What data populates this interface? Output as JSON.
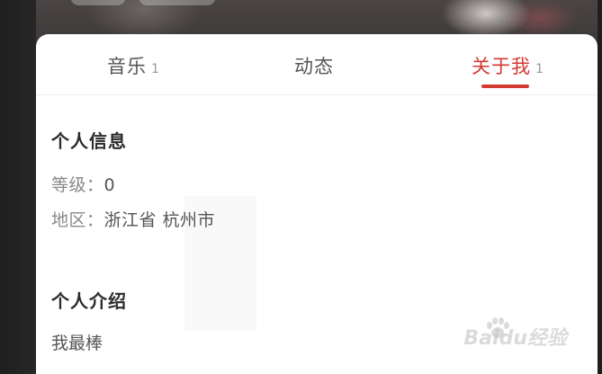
{
  "tabs": [
    {
      "label": "音乐",
      "count": "1",
      "active": false
    },
    {
      "label": "动态",
      "count": "",
      "active": false
    },
    {
      "label": "关于我",
      "count": "1",
      "active": true
    }
  ],
  "personal_info": {
    "title": "个人信息",
    "level_label": "等级：",
    "level_value": "0",
    "region_label": "地区：",
    "region_value": "浙江省 杭州市"
  },
  "intro": {
    "title": "个人介绍",
    "text": "我最棒"
  },
  "watermark": "Baidu经验",
  "colors": {
    "accent": "#d33a31",
    "card": "#ffffff",
    "background": "#2b2b2b"
  }
}
